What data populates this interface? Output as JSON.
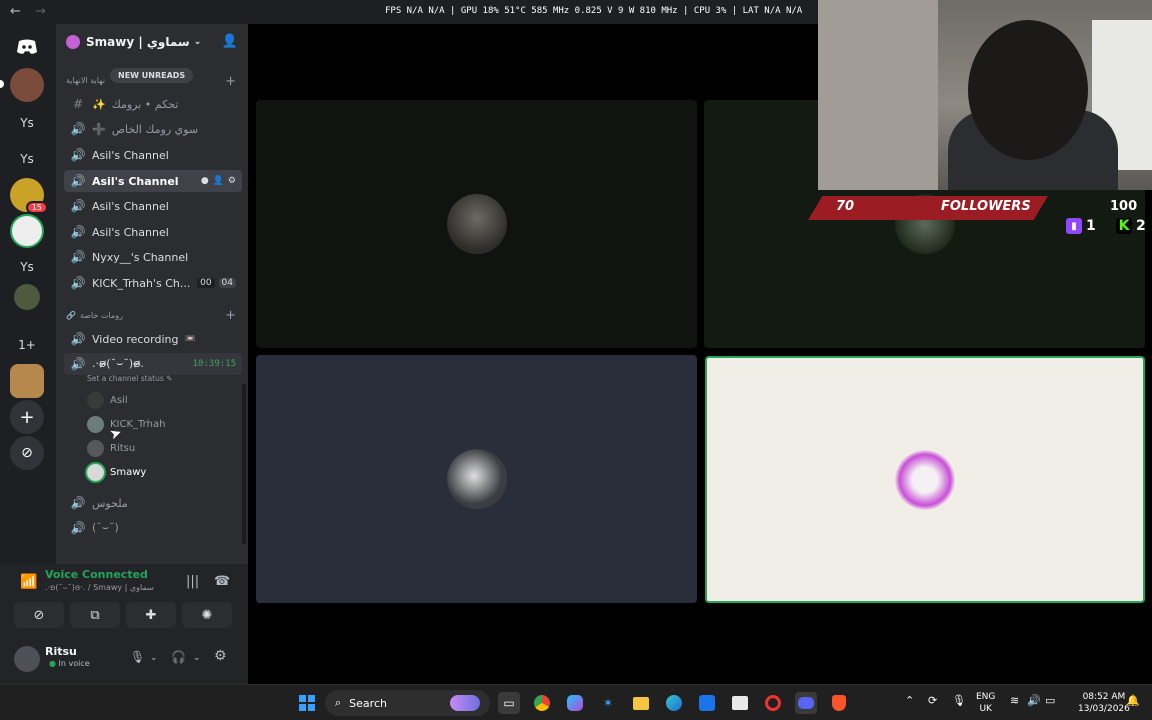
{
  "titlebar": {
    "window_title": "Smawy | سماوي",
    "stats": "FPS N/A N/A | GPU 18% 51°C 585 MHz 0.825 V 9 W 810 MHz | CPU 3% | LAT N/A N/A"
  },
  "server_rail": {
    "items": [
      "Ys",
      "Ys",
      "Ys",
      "1+"
    ],
    "badge": "15"
  },
  "server": {
    "name": "Smawy | سماوي",
    "new_unreads": "NEW UNREADS",
    "category_top": "نهاية الانهاية",
    "category_private": "رومات خاصة"
  },
  "channels": [
    {
      "name": "تحكم • برومك",
      "icon": "#",
      "emoji": "✨"
    },
    {
      "name": "سوي رومك الخاص",
      "icon": "speaker",
      "emoji": "➕"
    },
    {
      "name": "Asil's Channel",
      "icon": "speaker"
    },
    {
      "name": "Asil's Channel",
      "icon": "speaker"
    },
    {
      "name": "Asil's Channel",
      "icon": "speaker"
    },
    {
      "name": "Asil's Channel",
      "icon": "speaker"
    },
    {
      "name": "Nyxy__'s Channel",
      "icon": "speaker"
    },
    {
      "name": "KICK_Trhah's Ch...",
      "icon": "speaker",
      "counts": [
        "00",
        "04"
      ]
    },
    {
      "name": "Video recording",
      "icon": "speaker"
    },
    {
      "name": ".·ʚ̴̶̷̷(˘⌣˘)ɞ̴̶̷.",
      "icon": "speaker",
      "time": "10:39:15"
    },
    {
      "name": "ملحوس",
      "icon": "speaker"
    },
    {
      "name": "(˘⌣˘)",
      "icon": "speaker"
    }
  ],
  "channel_status_placeholder": "Set a channel status",
  "voice_members": [
    "Asil",
    "KICK_Trhah",
    "Ritsu",
    "Smawy"
  ],
  "voice_panel": {
    "title": "Voice Connected",
    "subtitle": ".·ʚ(˘⌣˘)ɞ·. / Smawy | سماوي"
  },
  "user_panel": {
    "name": "Ritsu",
    "status": "In voice"
  },
  "overlay": {
    "left_count": "70",
    "label": "FOLLOWERS",
    "right_count": "100",
    "twitch_count": "1",
    "kick_count": "2"
  },
  "taskbar": {
    "search_placeholder": "Search",
    "lang_top": "ENG",
    "lang_bottom": "UK",
    "time": "08:52 AM",
    "date": "13/03/2026"
  },
  "colors": {
    "discord_green": "#23a55a",
    "sidebar_bg": "#2b2d31",
    "rail_bg": "#1e1f22",
    "banner_red": "#9c1c24"
  }
}
